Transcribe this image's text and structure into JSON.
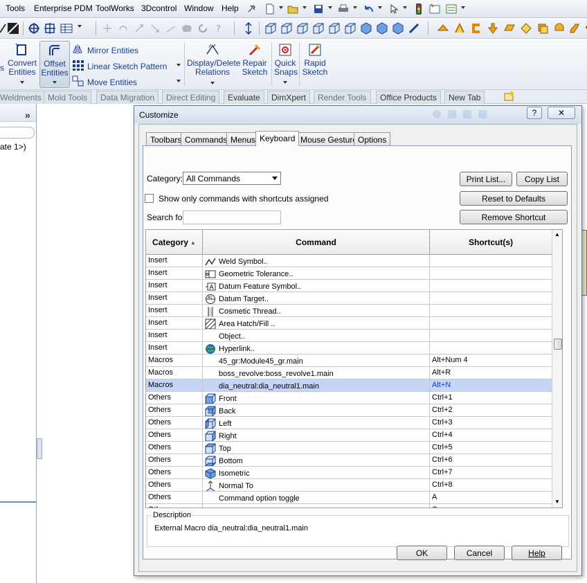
{
  "menubar": {
    "items": [
      "Tools",
      "Enterprise PDM",
      "ToolWorks",
      "3Dcontrol",
      "Window",
      "Help"
    ]
  },
  "ribbon": {
    "convert_entities": [
      "Convert",
      "Entities"
    ],
    "offset_entities": [
      "Offset",
      "Entities"
    ],
    "mirror_entities": "Mirror Entities",
    "linear_sketch_pattern": "Linear Sketch Pattern",
    "move_entities": "Move Entities",
    "display_delete_relations": [
      "Display/Delete",
      "Relations"
    ],
    "repair_sketch": [
      "Repair",
      "Sketch"
    ],
    "quick_snaps": [
      "Quick",
      "Snaps"
    ],
    "rapid_sketch": [
      "Rapid",
      "Sketch"
    ],
    "left_partial": "s"
  },
  "cm_tabs": [
    "Weldments",
    "Mold Tools",
    "Data Migration",
    "Direct Editing",
    "Evaluate",
    "DimXpert",
    "Render Tools",
    "Office Products",
    "New Tab"
  ],
  "left_panel": {
    "chevron": "»",
    "tree_item": "ate 1>)"
  },
  "dialog": {
    "title": "Customize",
    "help_glyph": "?",
    "close_glyph": "✕",
    "tabs": [
      "Toolbars",
      "Commands",
      "Menus",
      "Keyboard",
      "Mouse Gestures",
      "Options"
    ],
    "active_tab": "Keyboard",
    "category_label": "Category:",
    "category_value": "All Commands",
    "show_only_label": "Show only commands with shortcuts assigned",
    "search_label": "Search for:",
    "search_value": "",
    "buttons": {
      "print_list": "Print List...",
      "copy_list": "Copy List",
      "reset_defaults": "Reset to Defaults",
      "remove_shortcut": "Remove Shortcut",
      "ok": "OK",
      "cancel": "Cancel",
      "help": "Help"
    },
    "columns": [
      "Category",
      "Command",
      "Shortcut(s)"
    ],
    "rows": [
      {
        "category": "Insert",
        "command": "Weld Symbol..",
        "shortcut": "",
        "icon": "weld-symbol-icon"
      },
      {
        "category": "Insert",
        "command": "Geometric Tolerance..",
        "shortcut": "",
        "icon": "geometric-tolerance-icon"
      },
      {
        "category": "Insert",
        "command": "Datum Feature Symbol..",
        "shortcut": "",
        "icon": "datum-feature-icon"
      },
      {
        "category": "Insert",
        "command": "Datum Target..",
        "shortcut": "",
        "icon": "datum-target-icon"
      },
      {
        "category": "Insert",
        "command": "Cosmetic Thread..",
        "shortcut": "",
        "icon": "cosmetic-thread-icon"
      },
      {
        "category": "Insert",
        "command": "Area Hatch/Fill ..",
        "shortcut": "",
        "icon": "area-hatch-icon"
      },
      {
        "category": "Insert",
        "command": "Object..",
        "shortcut": "",
        "icon": ""
      },
      {
        "category": "Insert",
        "command": "Hyperlink..",
        "shortcut": "",
        "icon": "hyperlink-globe-icon"
      },
      {
        "category": "Macros",
        "command": "45_gr:Module45_gr.main",
        "shortcut": "Alt+Num 4",
        "icon": ""
      },
      {
        "category": "Macros",
        "command": "boss_revolve:boss_revolve1.main",
        "shortcut": "Alt+R",
        "icon": ""
      },
      {
        "category": "Macros",
        "command": "dia_neutral:dia_neutral1.main",
        "shortcut": "Alt+N",
        "icon": "",
        "selected": true
      },
      {
        "category": "Others",
        "command": "Front",
        "shortcut": "Ctrl+1",
        "icon": "view-front-icon"
      },
      {
        "category": "Others",
        "command": "Back",
        "shortcut": "Ctrl+2",
        "icon": "view-back-icon"
      },
      {
        "category": "Others",
        "command": "Left",
        "shortcut": "Ctrl+3",
        "icon": "view-left-icon"
      },
      {
        "category": "Others",
        "command": "Right",
        "shortcut": "Ctrl+4",
        "icon": "view-right-icon"
      },
      {
        "category": "Others",
        "command": "Top",
        "shortcut": "Ctrl+5",
        "icon": "view-top-icon"
      },
      {
        "category": "Others",
        "command": "Bottom",
        "shortcut": "Ctrl+6",
        "icon": "view-bottom-icon"
      },
      {
        "category": "Others",
        "command": "Isometric",
        "shortcut": "Ctrl+7",
        "icon": "view-isometric-icon"
      },
      {
        "category": "Others",
        "command": "Normal To",
        "shortcut": "Ctrl+8",
        "icon": "normal-to-icon"
      },
      {
        "category": "Others",
        "command": "Command option toggle",
        "shortcut": "A",
        "icon": ""
      },
      {
        "category": "Others",
        "command": "Expand/Collapse Tree",
        "shortcut": "C",
        "icon": ""
      }
    ],
    "description_label": "Description",
    "description_text": "External Macro dia_neutral:dia_neutral1.main"
  },
  "colors": {
    "selection": "#c5d5f5",
    "ribbon_text": "#1a3c8c",
    "shortcut_selected": "#1a3ad8"
  }
}
